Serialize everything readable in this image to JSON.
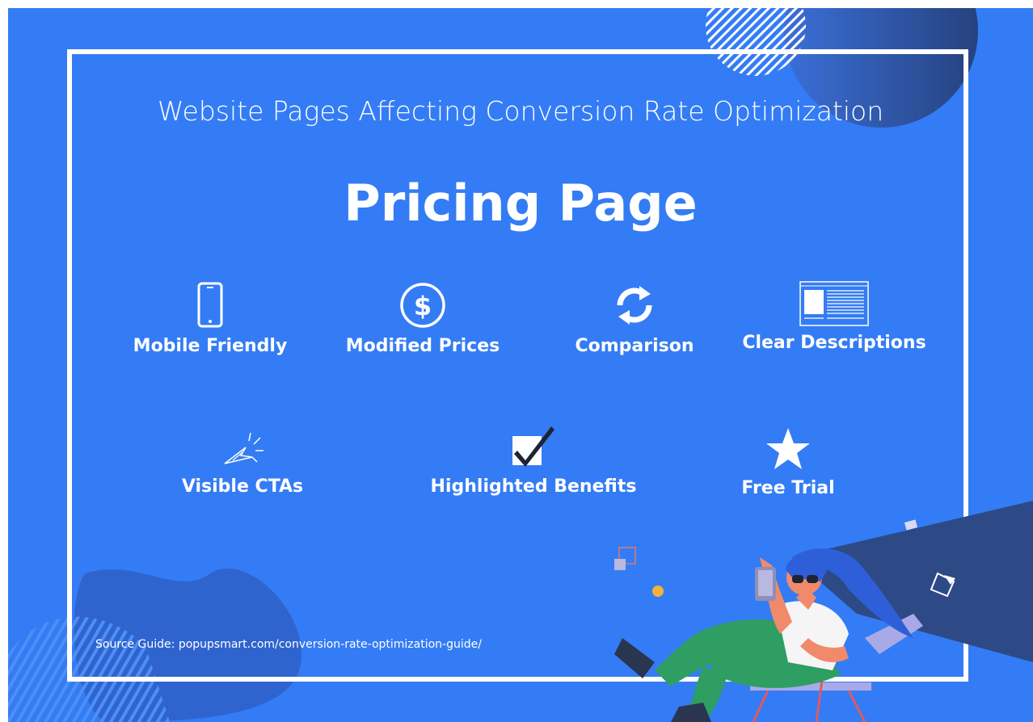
{
  "header": {
    "subtitle": "Website Pages Affecting  Conversion Rate Optimization",
    "title": "Pricing Page"
  },
  "features_row1": [
    {
      "label": "Mobile Friendly",
      "icon": "mobile-phone-icon"
    },
    {
      "label": "Modified Prices",
      "icon": "dollar-coin-icon"
    },
    {
      "label": "Comparison",
      "icon": "refresh-arrows-icon"
    },
    {
      "label": "Clear Descriptions",
      "icon": "document-layout-icon"
    }
  ],
  "features_row2": [
    {
      "label": "Visible CTAs",
      "icon": "cursor-click-icon"
    },
    {
      "label": "Highlighted Benefits",
      "icon": "checkbox-checked-icon"
    },
    {
      "label": "Free Trial",
      "icon": "star-icon"
    }
  ],
  "footer": {
    "source": "Source Guide: popupsmart.com/conversion-rate-optimization-guide/"
  },
  "colors": {
    "background": "#347cf5",
    "dark_accent": "#2d4a87",
    "white": "#ffffff"
  }
}
